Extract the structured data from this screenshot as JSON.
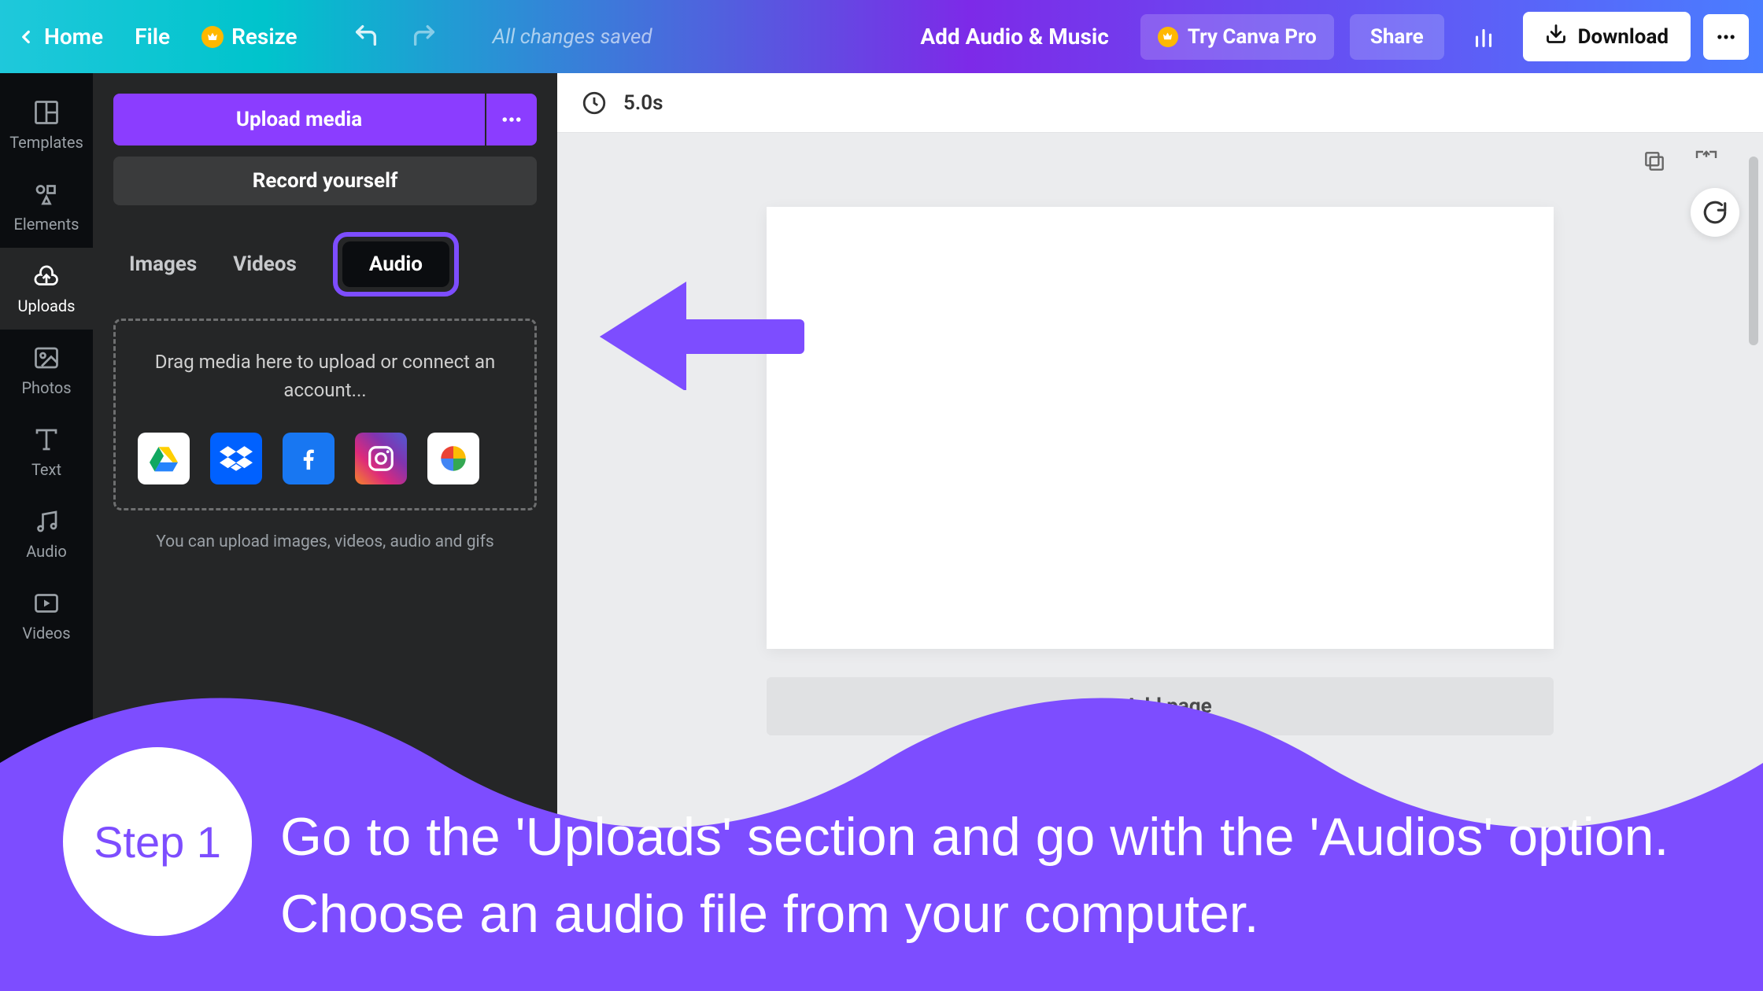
{
  "topbar": {
    "home": "Home",
    "file": "File",
    "resize": "Resize",
    "saved": "All changes saved",
    "doc_title": "Add Audio & Music",
    "try_pro": "Try Canva Pro",
    "share": "Share",
    "download": "Download"
  },
  "rail": {
    "templates": "Templates",
    "elements": "Elements",
    "uploads": "Uploads",
    "photos": "Photos",
    "text": "Text",
    "audio": "Audio",
    "videos": "Videos"
  },
  "panel": {
    "upload": "Upload media",
    "record": "Record yourself",
    "tab_images": "Images",
    "tab_videos": "Videos",
    "tab_audio": "Audio",
    "drop_text": "Drag media here to upload or connect an account...",
    "hint": "You can upload images, videos, audio and gifs"
  },
  "canvas": {
    "duration": "5.0s",
    "add_page": "+ Add page"
  },
  "tutorial": {
    "step": "Step 1",
    "text": "Go to the 'Uploads' section and go with the 'Audios' option. Choose an audio file from your computer."
  }
}
